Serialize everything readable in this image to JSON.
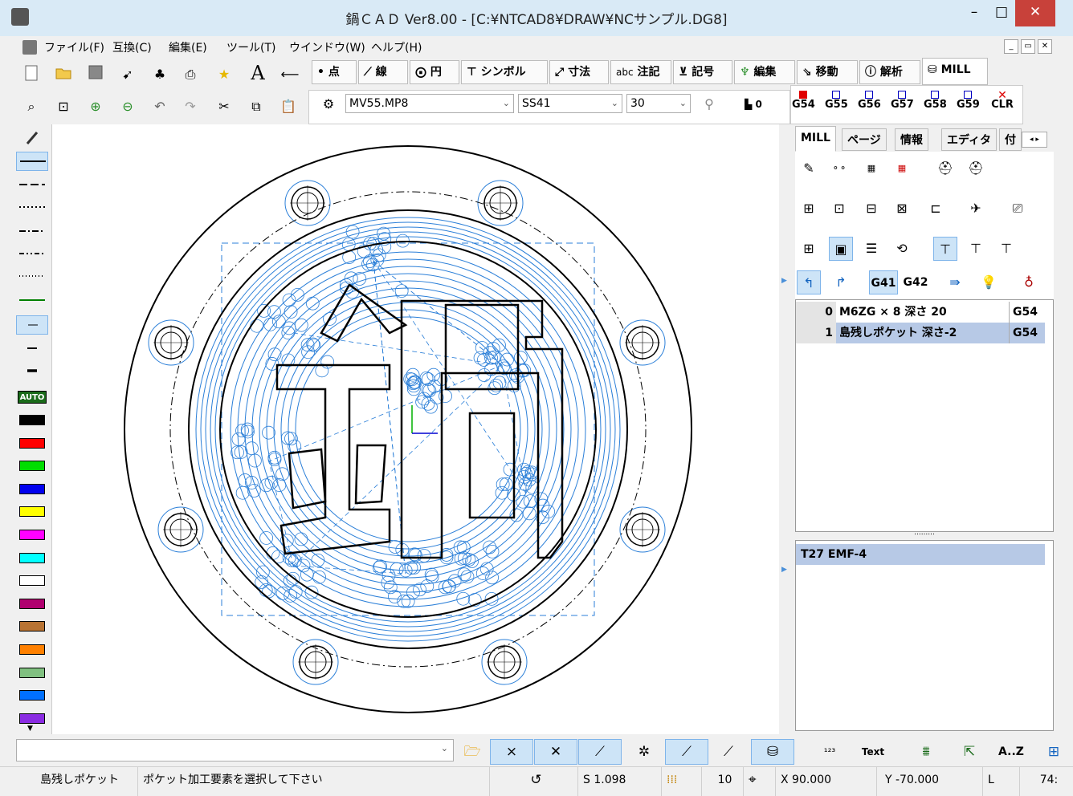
{
  "window": {
    "title": "鍋ＣＡＤ Ver8.00 - [C:¥NTCAD8¥DRAW¥NCサンプル.DG8]",
    "min_glyph": "–",
    "max_glyph": "□",
    "close_glyph": "✕"
  },
  "menu": {
    "items": [
      "ファイル(F)",
      "互換(C)",
      "編集(E)",
      "ツール(T)",
      "ウインドウ(W)",
      "ヘルプ(H)"
    ],
    "mdi": [
      "_",
      "▭",
      "✕"
    ]
  },
  "toolbar": {
    "commands": [
      "点",
      "線",
      "円",
      "シンボル",
      "寸法",
      "注記",
      "記号",
      "編集",
      "移動",
      "解析",
      "MILL"
    ],
    "command_icons": [
      "•",
      "⟋",
      "⨀",
      "⊤",
      "⤢",
      "abc",
      "⊻",
      "♆",
      "⇘",
      "ⓘ",
      "⛁"
    ],
    "text_glyph": "A",
    "machine": "MV55.MP8",
    "material": "SS41",
    "value": "30",
    "zero_label": "0",
    "g_codes": [
      "G54",
      "G55",
      "G56",
      "G57",
      "G58",
      "G59",
      "CLR"
    ]
  },
  "palette": {
    "auto_label": "AUTO",
    "colors": [
      "#000000",
      "#ff0000",
      "#00dd00",
      "#0000ee",
      "#ffff00",
      "#ff00ff",
      "#00ffff",
      "#ffffff",
      "#b0006f",
      "#b87333",
      "#ff8000",
      "#80c080",
      "#0070ff",
      "#8a2be2"
    ]
  },
  "right_panel": {
    "tabs": [
      "MILL",
      "ページ",
      "情報",
      "エディタ",
      "付"
    ],
    "g41": "G41",
    "g42": "G42",
    "operations": [
      {
        "num": "0",
        "name": "M6ZG × 8 深さ 20",
        "g": "G54"
      },
      {
        "num": "1",
        "name": "島残しポケット 深さ-2",
        "g": "G54"
      }
    ],
    "tool": "T27 EMF-4",
    "divider": "........."
  },
  "bottom": {
    "icons_text": [
      "Text",
      "A..Z"
    ]
  },
  "status": {
    "mode": "島残しポケット",
    "message": "ポケット加工要素を選択して下さい",
    "s_value": "S 1.098",
    "grid": "10",
    "x": "X 90.000",
    "y": "Y -70.000",
    "l_label": "L",
    "l_value": "74:"
  },
  "canvas_text": {
    "glyph": "鍋"
  }
}
